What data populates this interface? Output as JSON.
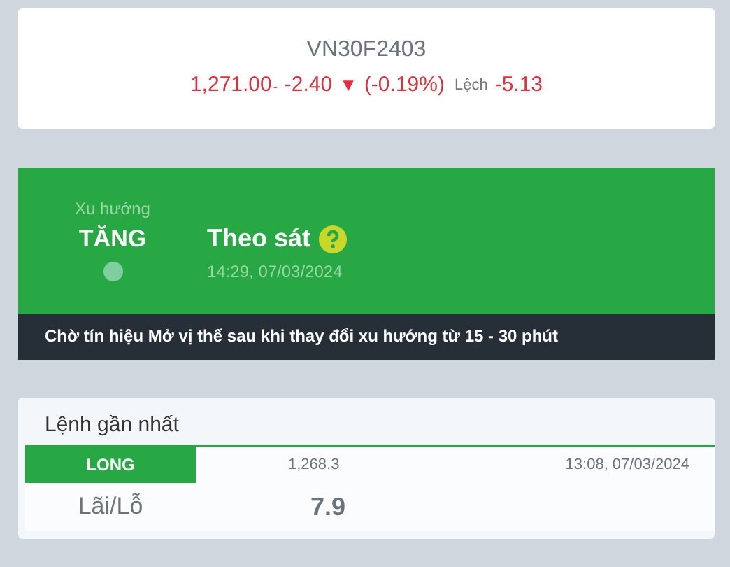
{
  "quote": {
    "symbol": "VN30F2403",
    "price": "1,271.00",
    "price_suffix": "-",
    "change": "-2.40",
    "arrow": "▼",
    "percent": "(-0.19%)",
    "basis_label": "Lệch",
    "basis": "-5.13"
  },
  "trend": {
    "label": "Xu hướng",
    "value": "TĂNG",
    "status": "Theo sát",
    "time": "14:29, 07/03/2024",
    "note": "Chờ tín hiệu Mở vị thế sau khi thay đổi xu hướng từ 15 - 30 phút"
  },
  "last_order": {
    "title": "Lệnh gần nhất",
    "side": "LONG",
    "kind": "long",
    "price": "1,268.3",
    "time": "13:08, 07/03/2024",
    "pnl_label": "Lãi/Lỗ",
    "pnl": "7.9"
  }
}
